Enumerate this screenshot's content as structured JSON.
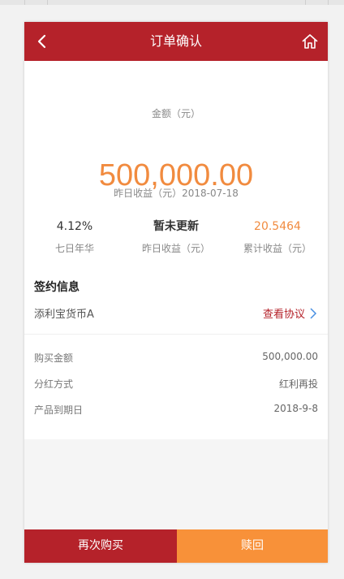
{
  "header": {
    "title": "订单确认"
  },
  "summary": {
    "amount_label": "金额（元）",
    "amount_value": "500,000.00",
    "yesterday_line": "昨日收益（元）2018-07-18",
    "stats": [
      {
        "value": "4.12%",
        "label": "七日年华"
      },
      {
        "value": "暂未更新",
        "label": "昨日收益（元）"
      },
      {
        "value": "20.5464",
        "label": "累计收益（元）"
      }
    ]
  },
  "sign_info": {
    "title": "签约信息",
    "product_name": "添利宝货币A",
    "view_agreement": "查看协议",
    "details": [
      {
        "label": "购买金额",
        "value": "500,000.00"
      },
      {
        "label": "分红方式",
        "value": "红利再投"
      },
      {
        "label": "产品到期日",
        "value": "2018-9-8"
      }
    ]
  },
  "actions": {
    "buy_again": "再次购买",
    "redeem": "赎回"
  },
  "colors": {
    "brand": "#b5222a",
    "accent": "#f18b3f",
    "redeem_button": "#f89139"
  },
  "icons": {
    "back": "chevron-left-icon",
    "home": "home-icon",
    "link": "chevron-right-icon"
  }
}
